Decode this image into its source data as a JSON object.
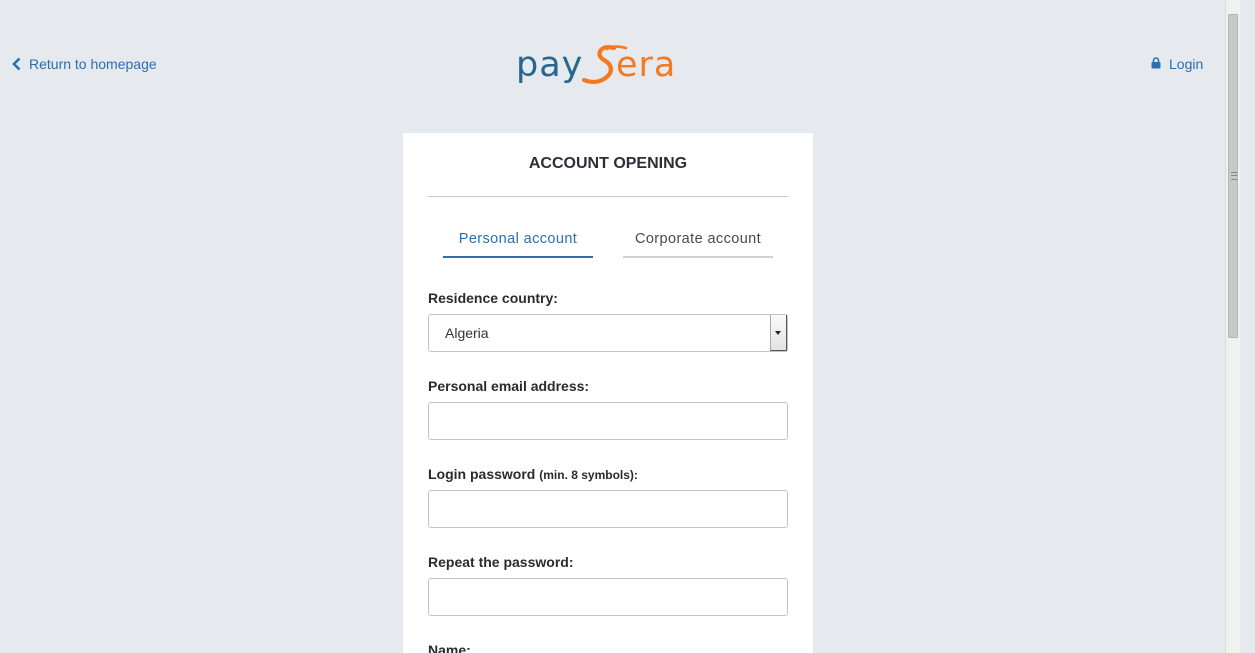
{
  "header": {
    "back_link_label": "Return to homepage",
    "login_label": "Login",
    "logo_text_left": "pay",
    "logo_text_right": "era",
    "colors": {
      "link": "#2a6fb0",
      "logo_blue": "#27668f",
      "logo_orange": "#f47920"
    }
  },
  "card": {
    "title": "ACCOUNT OPENING",
    "tabs": [
      {
        "label": "Personal account",
        "active": true
      },
      {
        "label": "Corporate account",
        "active": false
      }
    ],
    "fields": {
      "residence_country": {
        "label": "Residence country:",
        "value": "Algeria"
      },
      "email": {
        "label": "Personal email address:",
        "value": ""
      },
      "password": {
        "label": "Login password",
        "hint": "(min. 8 symbols):",
        "value": ""
      },
      "repeat_password": {
        "label": "Repeat the password:",
        "value": ""
      },
      "name": {
        "label": "Name:"
      }
    }
  },
  "icons": {
    "back": "chevron-left-icon",
    "login": "lock-icon",
    "select": "caret-down-icon"
  }
}
